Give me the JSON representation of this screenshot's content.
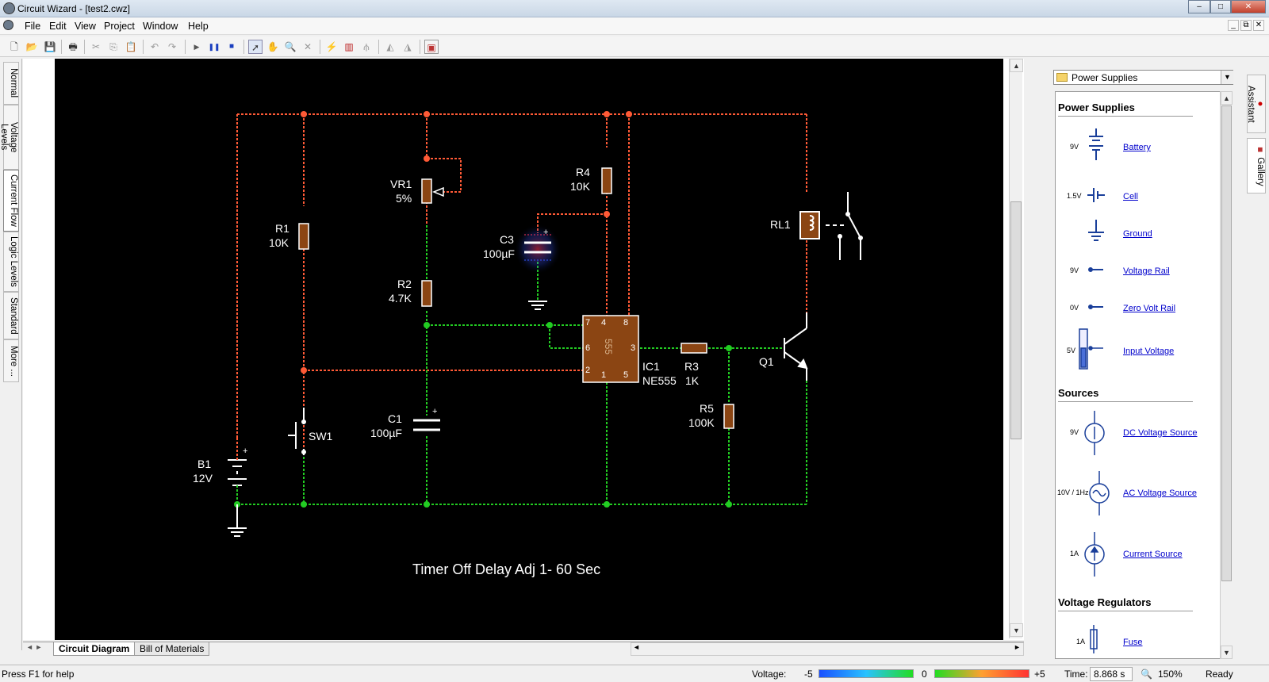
{
  "window": {
    "title": "Circuit Wizard - [test2.cwz]",
    "min": "–",
    "max": "□",
    "close": "✕",
    "mdi_min": "_",
    "mdi_restore": "⧉",
    "mdi_close": "✕"
  },
  "menu": [
    "File",
    "Edit",
    "View",
    "Project",
    "Window",
    "Help"
  ],
  "toolbar": [
    {
      "name": "new-icon",
      "glyph": "🗋"
    },
    {
      "name": "open-icon",
      "glyph": "📂"
    },
    {
      "name": "save-icon",
      "glyph": "💾"
    },
    {
      "name": "print-icon",
      "glyph": "🖶"
    },
    {
      "name": "cut-icon",
      "glyph": "✂"
    },
    {
      "name": "copy-icon",
      "glyph": "⎘"
    },
    {
      "name": "paste-icon",
      "glyph": "📋"
    },
    {
      "name": "undo-icon",
      "glyph": "↶"
    },
    {
      "name": "redo-icon",
      "glyph": "↷"
    },
    {
      "name": "play-icon",
      "glyph": "▶"
    },
    {
      "name": "pause-icon",
      "glyph": "❚❚"
    },
    {
      "name": "stop-icon",
      "glyph": "■"
    },
    {
      "name": "select-icon",
      "glyph": "➚"
    },
    {
      "name": "pan-icon",
      "glyph": "✋"
    },
    {
      "name": "zoom-icon",
      "glyph": "🔍"
    },
    {
      "name": "delete-icon",
      "glyph": "✕"
    },
    {
      "name": "probe-icon",
      "glyph": "⚡"
    },
    {
      "name": "graph-icon",
      "glyph": "▥"
    },
    {
      "name": "tree-icon",
      "glyph": "⫛"
    },
    {
      "name": "flip-h-icon",
      "glyph": "◭"
    },
    {
      "name": "flip-v-icon",
      "glyph": "◮"
    },
    {
      "name": "pcb-icon",
      "glyph": "▣"
    }
  ],
  "left_tabs": [
    "Normal",
    "Voltage Levels",
    "Current Flow",
    "Logic Levels",
    "Standard",
    "More ..."
  ],
  "doc_tabs": [
    "Circuit Diagram",
    "Bill of Materials"
  ],
  "circuit": {
    "caption": "Timer Off Delay Adj 1- 60 Sec",
    "labels": {
      "b1": "B1",
      "b1v": "12V",
      "r1": "R1",
      "r1v": "10K",
      "sw1": "SW1",
      "vr1": "VR1",
      "vr1v": "5%",
      "r2": "R2",
      "r2v": "4.7K",
      "c1": "C1",
      "c1v": "100µF",
      "c3": "C3",
      "c3v": "100µF",
      "r4": "R4",
      "r4v": "10K",
      "ic1": "IC1",
      "ic1v": "NE555",
      "ic_chip": "555",
      "p7": "7",
      "p4": "4",
      "p8": "8",
      "p6": "6",
      "p3": "3",
      "p2": "2",
      "p1": "1",
      "p5": "5",
      "r3": "R3",
      "r3v": "1K",
      "r5": "R5",
      "r5v": "100K",
      "q1": "Q1",
      "rl1": "RL1"
    },
    "colors": {
      "high": "#ff5a36",
      "low": "#22cc22",
      "wire_white": "#ffffff",
      "component": "#8b4513"
    }
  },
  "gallery": {
    "selected": "Power Supplies",
    "sections": [
      {
        "title": "Power Supplies",
        "items": [
          {
            "label": "Battery",
            "value": "9V",
            "icon": "battery-icon"
          },
          {
            "label": "Cell",
            "value": "1.5V",
            "icon": "cell-icon"
          },
          {
            "label": "Ground",
            "value": "",
            "icon": "ground-icon"
          },
          {
            "label": "Voltage Rail",
            "value": "9V",
            "icon": "voltage-rail-icon"
          },
          {
            "label": "Zero Volt Rail",
            "value": "0V",
            "icon": "zero-volt-rail-icon"
          },
          {
            "label": "Input Voltage",
            "value": "5V",
            "icon": "input-voltage-icon"
          }
        ]
      },
      {
        "title": "Sources",
        "items": [
          {
            "label": "DC Voltage Source",
            "value": "9V",
            "icon": "dc-source-icon"
          },
          {
            "label": "AC Voltage Source",
            "value": "10V / 1Hz",
            "icon": "ac-source-icon"
          },
          {
            "label": "Current Source",
            "value": "1A",
            "icon": "current-source-icon"
          }
        ]
      },
      {
        "title": "Voltage Regulators",
        "items": [
          {
            "label": "Fuse",
            "value": "1A",
            "icon": "fuse-icon"
          }
        ]
      }
    ]
  },
  "right_tabs": [
    "Assistant",
    "Gallery"
  ],
  "status": {
    "help": "Press F1 for help",
    "voltage_label": "Voltage:",
    "v_min": "-5",
    "v_mid": "0",
    "v_max": "+5",
    "time_label": "Time:",
    "time": "8.868 s",
    "zoom": "150%",
    "state": "Ready"
  }
}
